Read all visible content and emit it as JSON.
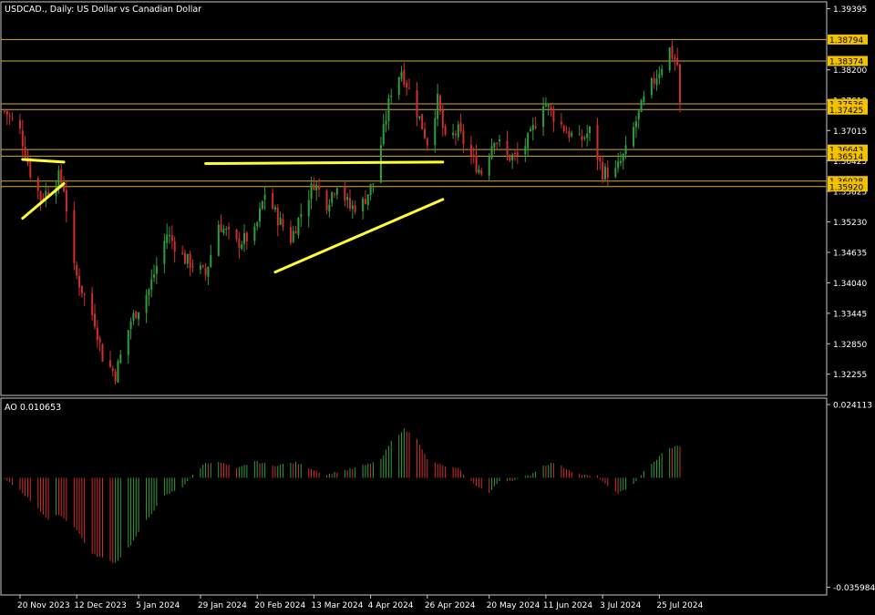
{
  "chart_title": "USDCAD., Daily:  US Dollar vs Canadian Dollar",
  "colors": {
    "background": "#000000",
    "frame": "#c8c8c8",
    "text": "#ffffff",
    "bull": "#2e9e3e",
    "bear": "#d22d2d",
    "level_line": "#d4aa3a",
    "level_label_bg": "#f2c200",
    "level_label_text": "#000000",
    "trendline": "#ffff33"
  },
  "chart_data": [
    {
      "type": "candlestick",
      "title": "USDCAD., Daily:  US Dollar vs Canadian Dollar",
      "y_ticks": [
        "1.39395",
        "1.38200",
        "1.37610",
        "1.37015",
        "1.36425",
        "1.35825",
        "1.35230",
        "1.34635",
        "1.34040",
        "1.33445",
        "1.32850",
        "1.32255"
      ],
      "x_ticks": [
        "20 Nov 2023",
        "12 Dec 2023",
        "5 Jan 2024",
        "29 Jan 2024",
        "20 Feb 2024",
        "13 Mar 2024",
        "4 Apr 2024",
        "26 Apr 2024",
        "20 May 2024",
        "11 Jun 2024",
        "3 Jul 2024",
        "25 Jul 2024"
      ],
      "ylim": [
        1.3184,
        1.3953
      ],
      "date_range": [
        "2023-11-14",
        "2024-08-02"
      ],
      "levels": [
        {
          "value": 1.38794,
          "label": "1.38794"
        },
        {
          "value": 1.38374,
          "label": "1.38374"
        },
        {
          "value": 1.37536,
          "label": "1.37536"
        },
        {
          "value": 1.37425,
          "label": "1.37425"
        },
        {
          "value": 1.36643,
          "label": "1.36643"
        },
        {
          "value": 1.36514,
          "label": "1.36514"
        },
        {
          "value": 1.36028,
          "label": "1.36028"
        },
        {
          "value": 1.3592,
          "label": "1.35920"
        }
      ],
      "trendlines": [
        {
          "from": [
            "2023-11-21",
            1.3645
          ],
          "to": [
            "2023-12-07",
            1.364
          ]
        },
        {
          "from": [
            "2023-11-21",
            1.353
          ],
          "to": [
            "2023-12-07",
            1.3598
          ]
        },
        {
          "from": [
            "2024-01-31",
            1.3637
          ],
          "to": [
            "2024-05-02",
            1.364
          ]
        },
        {
          "from": [
            "2024-02-27",
            1.3425
          ],
          "to": [
            "2024-05-02",
            1.3567
          ]
        }
      ],
      "path": [
        [
          "2023-11-14",
          1.374
        ],
        [
          "2023-11-20",
          1.37
        ],
        [
          "2023-11-24",
          1.362
        ],
        [
          "2023-11-28",
          1.357
        ],
        [
          "2023-12-01",
          1.3585
        ],
        [
          "2023-12-05",
          1.361
        ],
        [
          "2023-12-07",
          1.359
        ],
        [
          "2023-12-11",
          1.343
        ],
        [
          "2023-12-14",
          1.339
        ],
        [
          "2023-12-19",
          1.333
        ],
        [
          "2023-12-22",
          1.326
        ],
        [
          "2023-12-27",
          1.3225
        ],
        [
          "2024-01-02",
          1.333
        ],
        [
          "2024-01-09",
          1.339
        ],
        [
          "2024-01-16",
          1.35
        ],
        [
          "2024-01-23",
          1.345
        ],
        [
          "2024-01-31",
          1.342
        ],
        [
          "2024-02-05",
          1.352
        ],
        [
          "2024-02-12",
          1.348
        ],
        [
          "2024-02-19",
          1.35
        ],
        [
          "2024-02-23",
          1.358
        ],
        [
          "2024-02-28",
          1.353
        ],
        [
          "2024-03-04",
          1.349
        ],
        [
          "2024-03-08",
          1.354
        ],
        [
          "2024-03-13",
          1.36
        ],
        [
          "2024-03-18",
          1.356
        ],
        [
          "2024-03-22",
          1.36
        ],
        [
          "2024-03-27",
          1.355
        ],
        [
          "2024-04-01",
          1.356
        ],
        [
          "2024-04-05",
          1.36
        ],
        [
          "2024-04-09",
          1.37
        ],
        [
          "2024-04-12",
          1.378
        ],
        [
          "2024-04-16",
          1.382
        ],
        [
          "2024-04-22",
          1.374
        ],
        [
          "2024-04-26",
          1.368
        ],
        [
          "2024-04-30",
          1.376
        ],
        [
          "2024-05-03",
          1.368
        ],
        [
          "2024-05-08",
          1.37
        ],
        [
          "2024-05-14",
          1.364
        ],
        [
          "2024-05-17",
          1.362
        ],
        [
          "2024-05-22",
          1.369
        ],
        [
          "2024-05-27",
          1.365
        ],
        [
          "2024-05-31",
          1.365
        ],
        [
          "2024-06-05",
          1.369
        ],
        [
          "2024-06-10",
          1.376
        ],
        [
          "2024-06-14",
          1.373
        ],
        [
          "2024-06-19",
          1.37
        ],
        [
          "2024-06-24",
          1.368
        ],
        [
          "2024-06-28",
          1.37
        ],
        [
          "2024-07-03",
          1.362
        ],
        [
          "2024-07-08",
          1.362
        ],
        [
          "2024-07-12",
          1.366
        ],
        [
          "2024-07-16",
          1.372
        ],
        [
          "2024-07-19",
          1.376
        ],
        [
          "2024-07-23",
          1.38
        ],
        [
          "2024-07-26",
          1.383
        ],
        [
          "2024-07-29",
          1.386
        ],
        [
          "2024-08-01",
          1.383
        ],
        [
          "2024-08-02",
          1.375
        ]
      ]
    },
    {
      "type": "bar",
      "title": "AO 0.010653",
      "y_ticks": [
        "0.024113",
        "-0.035984"
      ],
      "ylim": [
        -0.0385,
        0.0262
      ],
      "last_value": 0.010653,
      "path": [
        [
          "2023-11-14",
          -0.0005
        ],
        [
          "2023-11-20",
          -0.004
        ],
        [
          "2023-11-27",
          -0.01
        ],
        [
          "2023-12-01",
          -0.014
        ],
        [
          "2023-12-05",
          -0.012
        ],
        [
          "2023-12-11",
          -0.016
        ],
        [
          "2023-12-18",
          -0.025
        ],
        [
          "2023-12-27",
          -0.028
        ],
        [
          "2024-01-02",
          -0.022
        ],
        [
          "2024-01-08",
          -0.014
        ],
        [
          "2024-01-15",
          -0.006
        ],
        [
          "2024-01-22",
          -0.003
        ],
        [
          "2024-01-26",
          0.001
        ],
        [
          "2024-01-31",
          0.005
        ],
        [
          "2024-02-06",
          0.005
        ],
        [
          "2024-02-12",
          0.003
        ],
        [
          "2024-02-19",
          0.0055
        ],
        [
          "2024-02-26",
          0.004
        ],
        [
          "2024-03-01",
          0.0045
        ],
        [
          "2024-03-06",
          0.005
        ],
        [
          "2024-03-12",
          0.003
        ],
        [
          "2024-03-18",
          0.001
        ],
        [
          "2024-03-22",
          0.002
        ],
        [
          "2024-03-28",
          0.003
        ],
        [
          "2024-04-03",
          0.0045
        ],
        [
          "2024-04-08",
          0.006
        ],
        [
          "2024-04-12",
          0.012
        ],
        [
          "2024-04-17",
          0.016
        ],
        [
          "2024-04-22",
          0.013
        ],
        [
          "2024-04-26",
          0.006
        ],
        [
          "2024-05-02",
          0.004
        ],
        [
          "2024-05-08",
          0.003
        ],
        [
          "2024-05-14",
          -0.002
        ],
        [
          "2024-05-20",
          -0.005
        ],
        [
          "2024-05-24",
          -0.001
        ],
        [
          "2024-05-30",
          -0.0008
        ],
        [
          "2024-06-05",
          0.001
        ],
        [
          "2024-06-10",
          0.004
        ],
        [
          "2024-06-14",
          0.005
        ],
        [
          "2024-06-19",
          0.003
        ],
        [
          "2024-06-25",
          0.001
        ],
        [
          "2024-07-01",
          0.0005
        ],
        [
          "2024-07-05",
          -0.003
        ],
        [
          "2024-07-09",
          -0.005
        ],
        [
          "2024-07-12",
          -0.004
        ],
        [
          "2024-07-16",
          -0.001
        ],
        [
          "2024-07-20",
          0.003
        ],
        [
          "2024-07-24",
          0.006
        ],
        [
          "2024-07-27",
          0.009
        ],
        [
          "2024-07-30",
          0.01
        ],
        [
          "2024-08-02",
          0.0106
        ]
      ]
    }
  ]
}
